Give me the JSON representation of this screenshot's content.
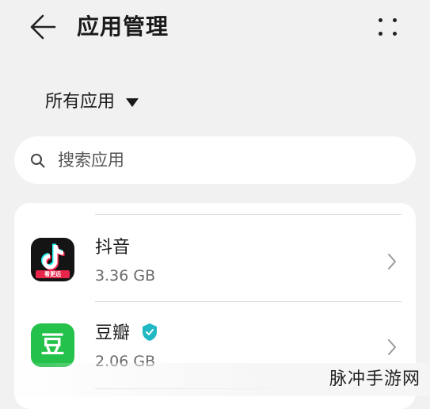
{
  "header": {
    "title": "应用管理"
  },
  "filter": {
    "label": "所有应用"
  },
  "search": {
    "placeholder": "搜索应用"
  },
  "apps": [
    {
      "name": "抖音",
      "size": "3.36 GB",
      "icon": "douyin-icon",
      "badge": "看更远"
    },
    {
      "name": "豆瓣",
      "size": "2.06 GB",
      "icon": "douban-icon",
      "glyph": "豆"
    }
  ],
  "watermark": {
    "text": "脉冲手游网"
  },
  "colors": {
    "background": "#f1f1f1",
    "card": "#ffffff",
    "douyin": "#141414",
    "douban": "#24c24a",
    "verified": "#1fb8c4"
  }
}
